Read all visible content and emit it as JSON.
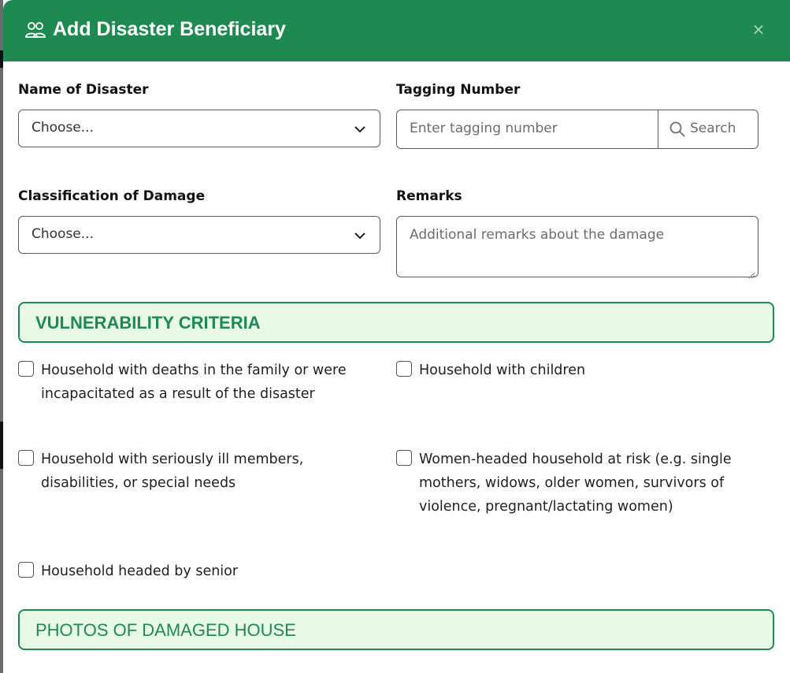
{
  "modal": {
    "title": "Add Disaster Beneficiary",
    "header_icon": "users-icon",
    "close_icon": "close-icon",
    "close_label": "×",
    "colors": {
      "header": "#1e8a52",
      "section_bg": "#e8f9e6",
      "section_border": "#1e8a52"
    }
  },
  "form": {
    "disaster": {
      "label": "Name of Disaster",
      "value": "Choose..."
    },
    "tagging": {
      "label": "Tagging Number",
      "placeholder": "Enter tagging number",
      "search_label": "Search",
      "search_icon": "search-icon"
    },
    "damage": {
      "label": "Classification of Damage",
      "value": "Choose..."
    },
    "remarks": {
      "label": "Remarks",
      "placeholder": "Additional remarks about the damage"
    }
  },
  "vulnerability": {
    "title": "VULNERABILITY CRITERIA",
    "items": [
      {
        "label": "Household with deaths in the family or were incapacitated as a result of the disaster",
        "checked": false
      },
      {
        "label": "Household with children",
        "checked": false
      },
      {
        "label": "Household with seriously ill members, disabilities, or special needs",
        "checked": false
      },
      {
        "label": "Women-headed household at risk (e.g. single mothers, widows, older women, survivors of violence, pregnant/lactating women)",
        "checked": false
      },
      {
        "label": "Household headed by senior",
        "checked": false
      }
    ]
  },
  "photos": {
    "title": "PHOTOS OF DAMAGED HOUSE"
  }
}
